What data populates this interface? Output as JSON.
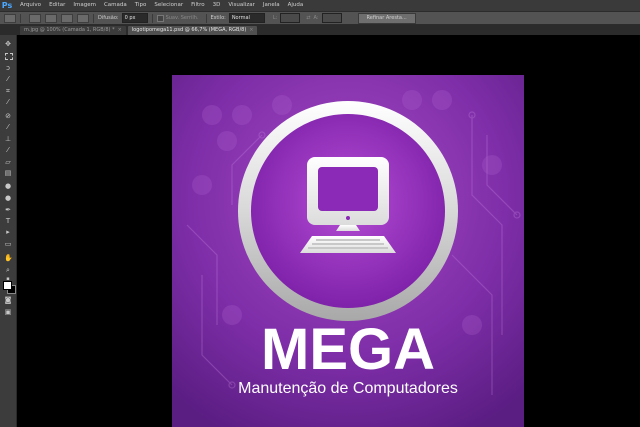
{
  "app": {
    "logo_text": "Ps"
  },
  "menu": [
    "Arquivo",
    "Editar",
    "Imagem",
    "Camada",
    "Tipo",
    "Selecionar",
    "Filtro",
    "3D",
    "Visualizar",
    "Janela",
    "Ajuda"
  ],
  "options": {
    "feather_label": "Difusão:",
    "feather_value": "0 px",
    "antialias_label": "Suav. Serrilh.",
    "style_label": "Estilo:",
    "style_value": "Normal",
    "width_label": "L:",
    "height_label": "A:",
    "refine_button": "Refinar Aresta..."
  },
  "tabs": [
    {
      "label": "m.jpg @ 100% (Camada 1, RGB/8) *",
      "active": false
    },
    {
      "label": "logotipomega11.psd @ 66,7% (MEGA, RGB/8)",
      "active": true
    }
  ],
  "tools": [
    "move-tool",
    "marquee-tool",
    "lasso-tool",
    "quick-select-tool",
    "crop-tool",
    "eyedropper-tool",
    "healing-tool",
    "brush-tool",
    "clone-stamp-tool",
    "history-brush-tool",
    "eraser-tool",
    "gradient-tool",
    "blur-tool",
    "dodge-tool",
    "pen-tool",
    "type-tool",
    "path-select-tool",
    "shape-tool",
    "hand-tool",
    "zoom-tool"
  ],
  "artwork": {
    "title": "MEGA",
    "subtitle": "Manutenção de Computadores",
    "colors": {
      "purple_light": "#a64ac4",
      "purple_dark": "#5a1d82",
      "white": "#ffffff"
    }
  },
  "colors": {
    "foreground": "#ffffff",
    "background": "#000000"
  }
}
